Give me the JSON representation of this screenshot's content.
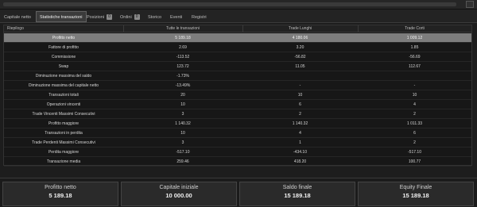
{
  "tabs": [
    {
      "label": "Capitale netto"
    },
    {
      "label": "Statistiche transazioni"
    },
    {
      "label": "Posizioni",
      "badge": "0"
    },
    {
      "label": "Ordini",
      "badge": "0"
    },
    {
      "label": "Storico"
    },
    {
      "label": "Eventi"
    },
    {
      "label": "Registri"
    }
  ],
  "table": {
    "headers": [
      "Riepilogo",
      "Tutte le transazioni",
      "Trade Lunghi",
      "Trade Corti"
    ],
    "rows": [
      [
        "Profitto netto",
        "5 189.18",
        "4 180.06",
        "1 009.12"
      ],
      [
        "Fattore di profitto",
        "2.69",
        "3.20",
        "1.85"
      ],
      [
        "Commissione",
        "-113.52",
        "-56.82",
        "-56.69"
      ],
      [
        "Swap",
        "123.72",
        "11.05",
        "112.67"
      ],
      [
        "Diminuzione massima del saldo",
        "-1.73%",
        "",
        ""
      ],
      [
        "Diminuzione massima del capitale netto",
        "-13.49%",
        "-",
        "-"
      ],
      [
        "Transazioni totali",
        "20",
        "10",
        "10"
      ],
      [
        "Operazioni vincenti",
        "10",
        "6",
        "4"
      ],
      [
        "Trade Vincenti Massimi Consecutivi",
        "3",
        "2",
        "2"
      ],
      [
        "Profitto maggiore",
        "1 140.32",
        "1 140.32",
        "1 011.33"
      ],
      [
        "Transazioni in perdita",
        "10",
        "4",
        "6"
      ],
      [
        "Trade Perdenti Massimi Consecutivi",
        "3",
        "1",
        "2"
      ],
      [
        "Perdita maggiore",
        "-517.10",
        "-434.10",
        "-517.10"
      ],
      [
        "Transazione media",
        "259.46",
        "418.20",
        "100.77"
      ]
    ]
  },
  "summary": [
    {
      "label": "Profitto netto",
      "value": "5 189.18"
    },
    {
      "label": "Capitale iniziale",
      "value": "10 000.00"
    },
    {
      "label": "Saldo finale",
      "value": "15 189.18"
    },
    {
      "label": "Equity Finale",
      "value": "15 189.18"
    }
  ]
}
